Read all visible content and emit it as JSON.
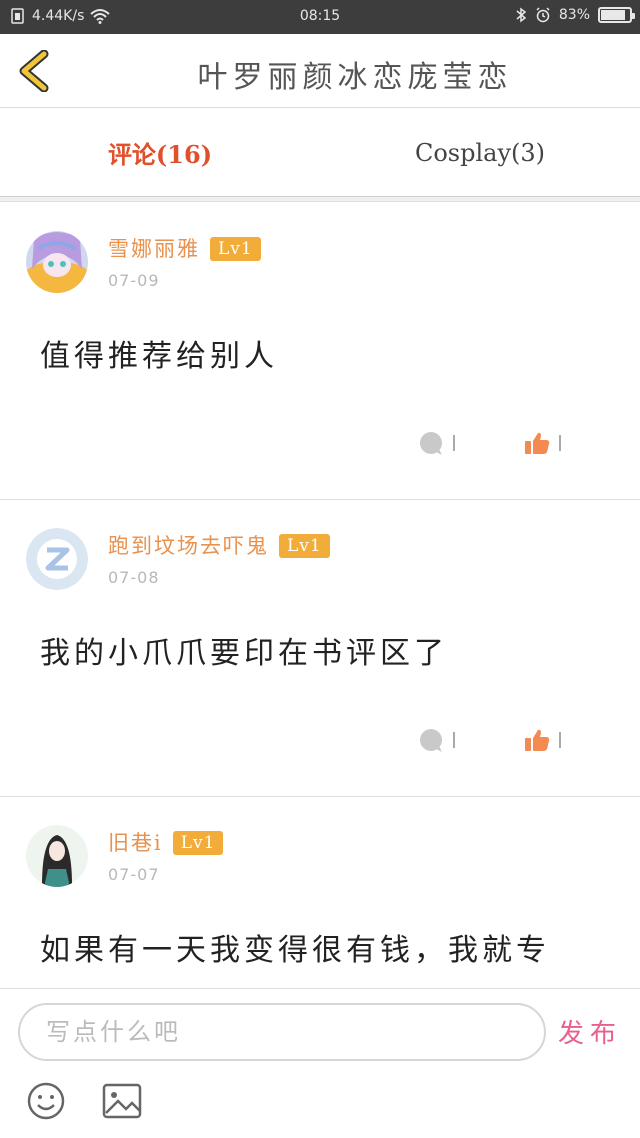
{
  "status_bar": {
    "network_speed": "4.44K/s",
    "time": "08:15",
    "battery": "83%",
    "battery_level": 0.83
  },
  "header": {
    "title": "叶罗丽颜冰恋庞莹恋",
    "back_icon": "chevron-left-icon",
    "accent": "#f0c53a"
  },
  "tabs": [
    {
      "label": "评论(16)",
      "active": true
    },
    {
      "label": "Cosplay(3)",
      "active": false
    }
  ],
  "comments": [
    {
      "username": "雪娜丽雅",
      "level": "Lv1",
      "date": "07-09",
      "content": "值得推荐给别人",
      "reply_count": "",
      "like_count": ""
    },
    {
      "username": "跑到坟场去吓鬼",
      "level": "Lv1",
      "date": "07-08",
      "content": "我的小爪爪要印在书评区了",
      "reply_count": "",
      "like_count": ""
    },
    {
      "username": "旧巷i",
      "level": "Lv1",
      "date": "07-07",
      "content": "如果有一天我变得很有钱，我就专",
      "reply_count": "",
      "like_count": ""
    }
  ],
  "composer": {
    "placeholder": "写点什么吧",
    "send_label": "发布",
    "send_color": "#ea5f8e"
  },
  "colors": {
    "active_tab": "#e0502c",
    "username": "#e8924e",
    "level_badge": "#f2ac3a",
    "like_icon": "#f28a52"
  }
}
